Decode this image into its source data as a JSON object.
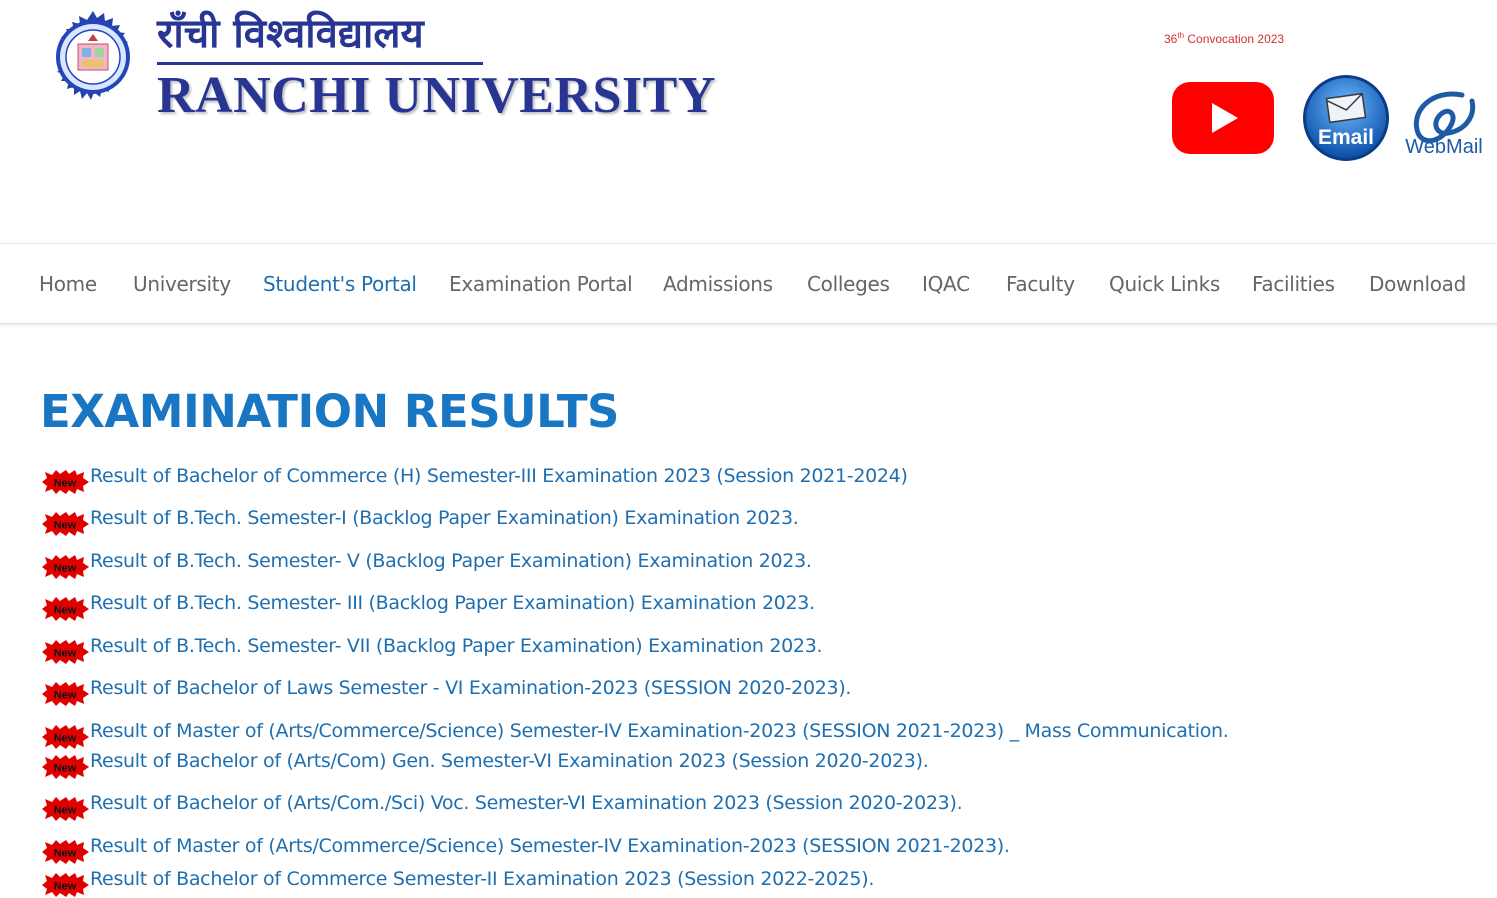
{
  "header": {
    "hindi_name": "राँची विश्वविद्यालय",
    "english_name": "RANCHI UNIVERSITY",
    "convocation": {
      "number": "36",
      "suffix": "th",
      "rest": " Convocation 2023"
    },
    "email_label": "Email",
    "webmail_label": "WebMail",
    "colors": {
      "brand": "#283593",
      "youtube": "#ff0000",
      "email": "#1565c0"
    }
  },
  "nav": {
    "items": [
      {
        "label": "Home"
      },
      {
        "label": "University"
      },
      {
        "label": "Student's Portal",
        "active": true
      },
      {
        "label": "Examination Portal"
      },
      {
        "label": "Admissions"
      },
      {
        "label": "Colleges"
      },
      {
        "label": "IQAC"
      },
      {
        "label": "Faculty"
      },
      {
        "label": "Quick Links"
      },
      {
        "label": "Facilities"
      },
      {
        "label": "Download"
      }
    ]
  },
  "main": {
    "title": "EXAMINATION RESULTS",
    "badge_label": "New",
    "results": [
      "Result of  Bachelor of Commerce (H) Semester-III Examination 2023 (Session 2021-2024)",
      "Result of B.Tech. Semester-I (Backlog Paper Examination) Examination 2023.",
      "Result of B.Tech. Semester- V (Backlog Paper Examination) Examination 2023.",
      "Result of B.Tech. Semester- III  (Backlog Paper Examination) Examination 2023.",
      "Result of B.Tech. Semester- VII (Backlog Paper Examination) Examination 2023.",
      "Result of Bachelor of Laws Semester - VI Examination-2023 (SESSION 2020-2023).",
      "Result of Master of (Arts/Commerce/Science) Semester-IV Examination-2023 (SESSION 2021-2023) _ Mass Communication.",
      "Result of Bachelor of (Arts/Com) Gen. Semester-VI Examination 2023 (Session 2020-2023).",
      "Result of  Bachelor of (Arts/Com./Sci) Voc. Semester-VI Examination 2023 (Session 2020-2023).",
      "Result of  Master of (Arts/Commerce/Science) Semester-IV Examination-2023 (SESSION 2021-2023).",
      "Result of Bachelor of Commerce Semester-II Examination 2023 (Session 2022-2025)."
    ]
  }
}
